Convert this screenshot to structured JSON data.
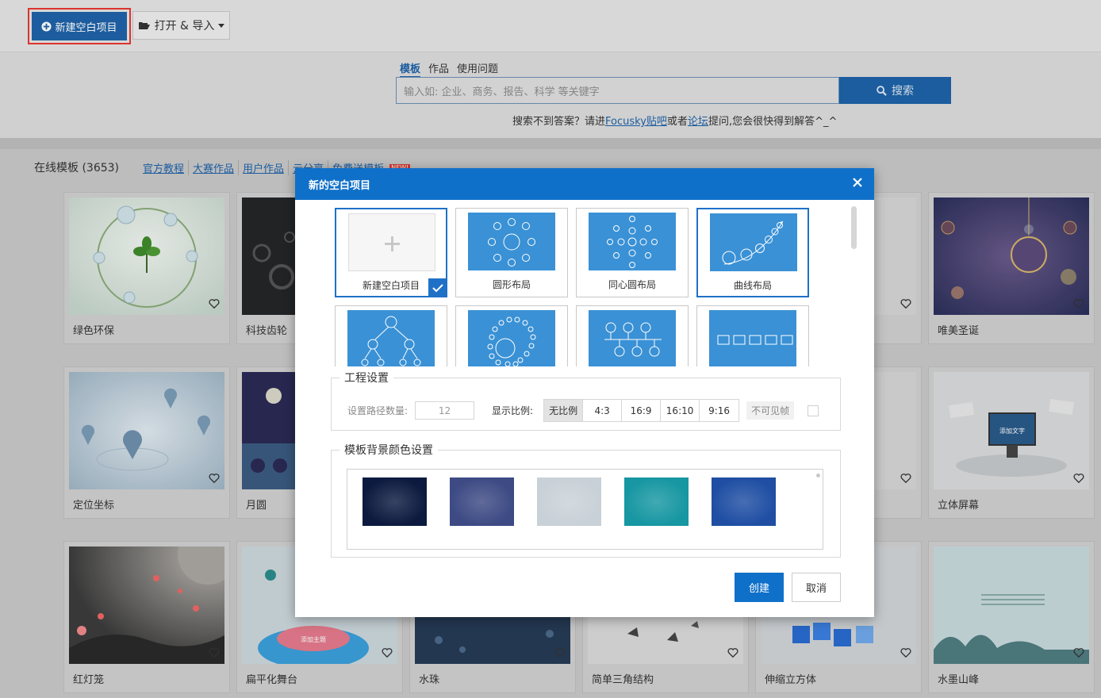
{
  "toolbar": {
    "new_project_label": "新建空白项目",
    "open_import_label": "打开 & 导入"
  },
  "search": {
    "tabs": [
      "模板",
      "作品",
      "使用问题"
    ],
    "placeholder": "输入如: 企业、商务、报告、科学 等关键字",
    "button_label": "搜索",
    "hint_prefix": "搜索不到答案？请进",
    "hint_link1": "Focusky贴吧",
    "hint_mid": "或者",
    "hint_link2": "论坛",
    "hint_suffix": "提问,您会很快得到解答^_^"
  },
  "section": {
    "title": "在线模板 (3653)",
    "links": [
      "官方教程",
      "大赛作品",
      "用户作品",
      "云分享",
      "免费送模板"
    ],
    "new_badge": "NEW!"
  },
  "templates": [
    {
      "name": "绿色环保"
    },
    {
      "name": "科技齿轮"
    },
    {
      "name": "唯美圣诞"
    },
    {
      "name": "定位坐标"
    },
    {
      "name": "月圆"
    },
    {
      "name": "立体屏幕"
    },
    {
      "name": "红灯笼"
    },
    {
      "name": "扁平化舞台"
    },
    {
      "name": "水珠"
    },
    {
      "name": "简单三角结构"
    },
    {
      "name": "伸缩立方体"
    },
    {
      "name": "水墨山峰"
    }
  ],
  "thumb_texts": {
    "screen": "添加文字",
    "stage": "添加主题"
  },
  "dialog": {
    "title": "新的空白项目",
    "layouts": [
      {
        "label": "新建空白项目"
      },
      {
        "label": "圆形布局"
      },
      {
        "label": "同心圆布局"
      },
      {
        "label": "曲线布局"
      },
      {
        "label": ""
      },
      {
        "label": ""
      },
      {
        "label": ""
      },
      {
        "label": ""
      }
    ],
    "project_settings": {
      "legend": "工程设置",
      "path_count_label": "设置路径数量:",
      "path_count_value": "12",
      "ratio_label": "显示比例:",
      "ratios": [
        "无比例",
        "4:3",
        "16:9",
        "16:10",
        "9:16"
      ],
      "active_ratio": "无比例",
      "invisible_frame_label": "不可见帧"
    },
    "background": {
      "legend": "模板背景颜色设置",
      "swatches": [
        "#0c1a3f",
        "#3d4a84",
        "#c9d1d8",
        "#1797a2",
        "#1f4ea3"
      ]
    },
    "create_label": "创建",
    "cancel_label": "取消"
  },
  "colors": {
    "accent": "#0f70c9",
    "highlight_border": "#e8372f",
    "layout_thumb": "#3a91d5"
  }
}
